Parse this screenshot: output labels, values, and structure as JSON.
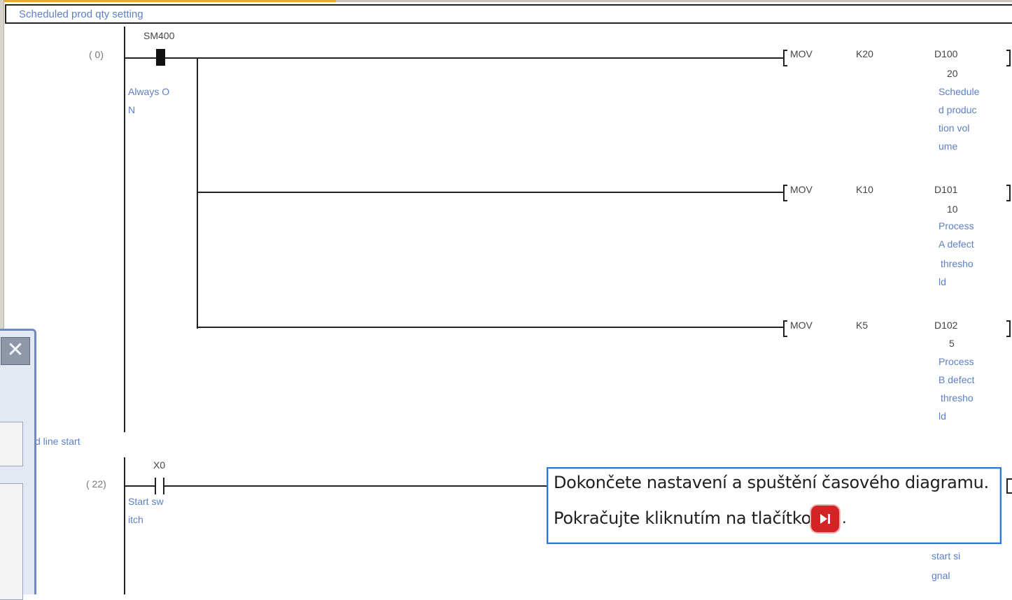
{
  "header": {
    "title": "Scheduled prod qty setting"
  },
  "rung1": {
    "step": "(     0)",
    "contact": {
      "device": "SM400",
      "comment_1": "Always O",
      "comment_2": "N"
    },
    "instructions": [
      {
        "op": "MOV",
        "src": "K20",
        "dst": "D100",
        "value": "20",
        "comment": [
          "Schedule",
          "d produc",
          "tion vol",
          "ume"
        ]
      },
      {
        "op": "MOV",
        "src": "K10",
        "dst": "D101",
        "value": "10",
        "comment": [
          "Process",
          "A defect",
          "thresho",
          "ld"
        ]
      },
      {
        "op": "MOV",
        "src": "K5",
        "dst": "D102",
        "value": "5",
        "comment": [
          "Process",
          "B defect",
          "thresho",
          "ld"
        ]
      }
    ]
  },
  "statement": "d line start",
  "rung2": {
    "step": "(    22)",
    "contact": {
      "device": "X0",
      "comment_1": "Start sw",
      "comment_2": "itch"
    },
    "coil_comment": [
      "start si",
      "gnal"
    ]
  },
  "tooltip": {
    "line1": "Dokončete nastavení a spuštění časového diagramu.",
    "line2": "Pokračujte kliknutím na tlačítko",
    "end": ".",
    "button_icon": "play-next-icon"
  },
  "panel": {
    "close_icon": "close-icon"
  },
  "colors": {
    "comment": "#5b7fc8",
    "tooltip_border": "#2a78d6",
    "button": "#d42324"
  }
}
